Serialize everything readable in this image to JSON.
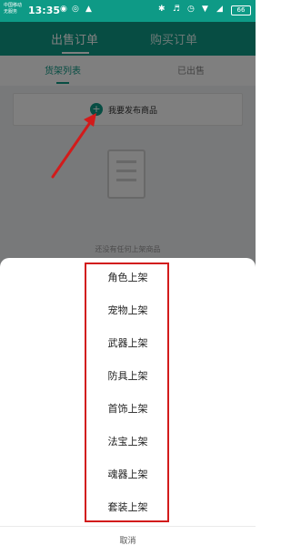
{
  "status_bar": {
    "carrier_line1": "中国移动",
    "carrier_line2": "无服务",
    "time": "13:35",
    "battery": "66"
  },
  "header": {
    "tabs": [
      {
        "label": "出售订单",
        "active": true
      },
      {
        "label": "购买订单",
        "active": false
      }
    ]
  },
  "sub_tabs": [
    {
      "label": "货架列表",
      "active": true
    },
    {
      "label": "已出售",
      "active": false
    }
  ],
  "publish": {
    "label": "我要发布商品",
    "icon": "plus-icon"
  },
  "empty_state": {
    "text": "还没有任何上架商品"
  },
  "sheet": {
    "items": [
      "角色上架",
      "宠物上架",
      "武器上架",
      "防具上架",
      "首饰上架",
      "法宝上架",
      "魂器上架",
      "套装上架"
    ],
    "cancel": "取消"
  },
  "colors": {
    "accent": "#0e9a86",
    "highlight": "#d21b1b",
    "overlay": "rgba(0,0,0,0.5)"
  }
}
